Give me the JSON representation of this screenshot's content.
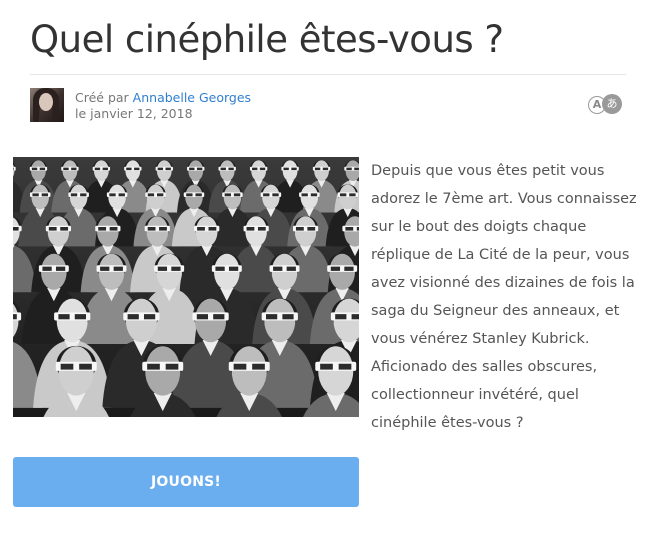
{
  "quiz": {
    "title": "Quel cinéphile êtes-vous ?",
    "created_by_label": "Créé par",
    "author": "Annabelle Georges",
    "date": "le janvier 12, 2018",
    "translate_icon_left": "A",
    "translate_icon_right": "あ",
    "description": "Depuis que vous êtes petit vous adorez le 7ème art. Vous connaissez sur le bout des doigts chaque réplique de La Cité de la peur, vous avez visionné des dizaines de fois la saga du Seigneur des anneaux, et vous vénérez Stanley Kubrick. Aficionado des salles obscures, collectionneur invétéré, quel cinéphile êtes-vous ?",
    "play_button": "JOUONS!"
  }
}
